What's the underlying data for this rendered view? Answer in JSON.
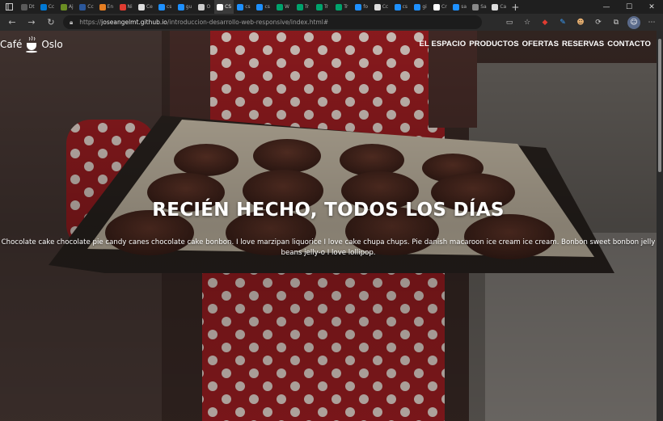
{
  "browser": {
    "url_prefix": "https://",
    "url_host": "joseangelmt.github.io",
    "url_path": "/introduccion-desarrollo-web-responsive/index.html#",
    "tabs": [
      {
        "label": "Dt",
        "color": "#5a5a5a"
      },
      {
        "label": "Cc",
        "color": "#0078d4"
      },
      {
        "label": "Aj",
        "color": "#6b8e23"
      },
      {
        "label": "Cc",
        "color": "#2b579a"
      },
      {
        "label": "En",
        "color": "#e67e22"
      },
      {
        "label": "Ni",
        "color": "#e03c31"
      },
      {
        "label": "Ce",
        "color": "#dddddd"
      },
      {
        "label": "cs",
        "color": "#1e90ff"
      },
      {
        "label": "gu",
        "color": "#1e90ff"
      },
      {
        "label": "O",
        "color": "#cccccc"
      },
      {
        "label": "CS",
        "color": "#ffffff"
      },
      {
        "label": "cs",
        "color": "#1e90ff"
      },
      {
        "label": "cs",
        "color": "#1e90ff"
      },
      {
        "label": "W",
        "color": "#00a36c"
      },
      {
        "label": "Tr",
        "color": "#00a36c"
      },
      {
        "label": "Tr",
        "color": "#00a36c"
      },
      {
        "label": "Tr",
        "color": "#00a36c"
      },
      {
        "label": "fo",
        "color": "#1e90ff"
      },
      {
        "label": "Cc",
        "color": "#dddddd"
      },
      {
        "label": "cs",
        "color": "#1e90ff"
      },
      {
        "label": "gi",
        "color": "#1e90ff"
      },
      {
        "label": "Cr",
        "color": "#ffffff"
      },
      {
        "label": "sa",
        "color": "#1e90ff"
      },
      {
        "label": "Sa",
        "color": "#888888"
      },
      {
        "label": "Ca",
        "color": "#dddddd"
      }
    ]
  },
  "site": {
    "brand_left": "Café",
    "brand_right": "Oslo",
    "nav": [
      "EL ESPACIO",
      "PRODUCTOS",
      "OFERTAS",
      "RESERVAS",
      "CONTACTO"
    ],
    "headline": "RECIÉN HECHO, TODOS LOS DÍAS",
    "subtext": "Chocolate cake chocolate pie candy canes chocolate cake bonbon. I love marzipan liquorice I love cake chupa chups. Pie danish macaroon ice cream ice cream. Bonbon sweet bonbon jelly beans jelly-o I love lollipop."
  }
}
